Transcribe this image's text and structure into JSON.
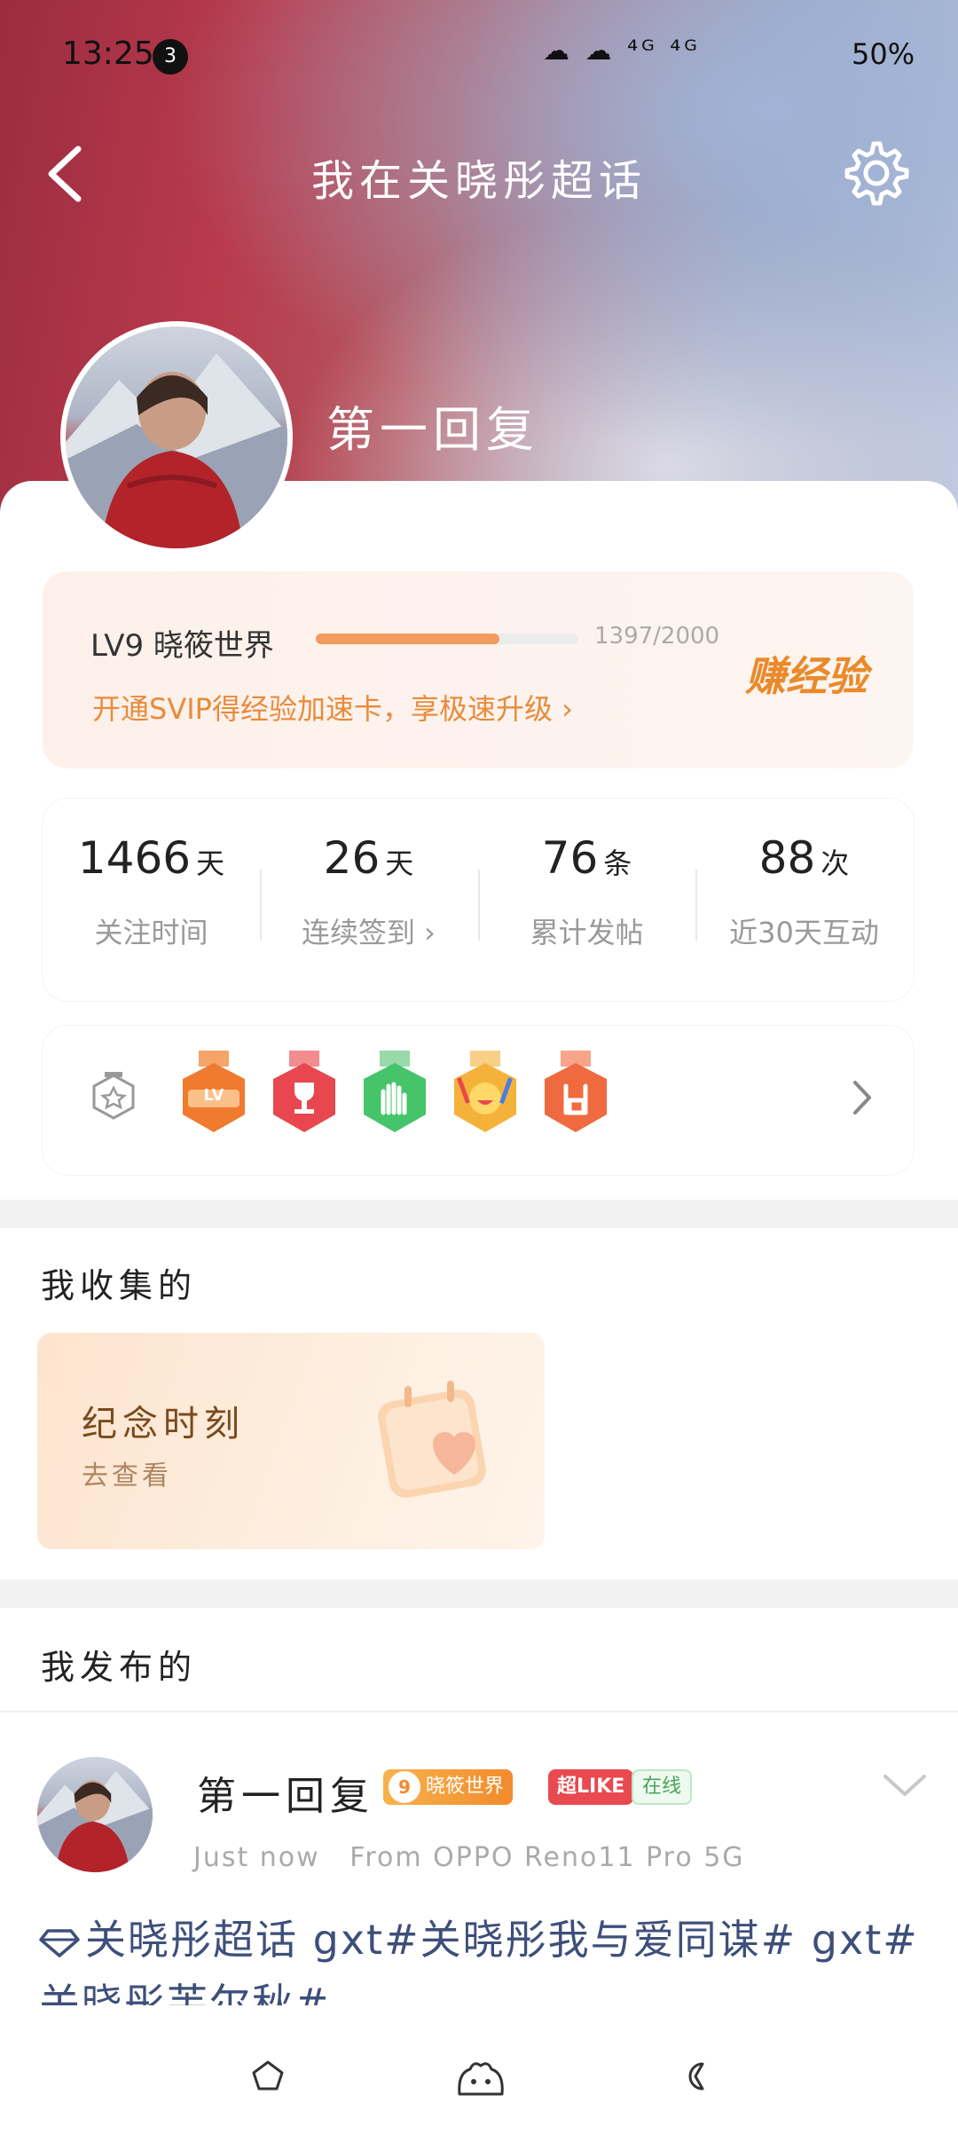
{
  "status_bar": {
    "time": "13:25",
    "notification_count": "3",
    "icons_text": "☁ ☁ ⁴ᴳ ⁴ᴳ",
    "battery": "50%"
  },
  "nav": {
    "title": "我在关晓彤超话",
    "back_icon": "chevron-left-icon",
    "settings_icon": "gear-icon"
  },
  "profile": {
    "name": "第一回复"
  },
  "level": {
    "name": "LV9 晓筱世界",
    "progress_text": "1397/2000",
    "progress_fraction": 0.6985,
    "earn_label": "赚经验",
    "svip_promo": "开通SVIP得经验加速卡，享极速升级",
    "promo_chevron": "›"
  },
  "stats": [
    {
      "value": "1466",
      "unit": "天",
      "label": "关注时间"
    },
    {
      "value": "26",
      "unit": "天",
      "label": "连续签到 ›"
    },
    {
      "value": "76",
      "unit": "条",
      "label": "累计发帖"
    },
    {
      "value": "88",
      "unit": "次",
      "label": "近30天互动"
    }
  ],
  "badges": {
    "medals": [
      {
        "name": "lv-medal",
        "label": "LV",
        "color": "#f07a2e"
      },
      {
        "name": "trophy-medal",
        "label": "",
        "color": "#e8474f"
      },
      {
        "name": "hand-medal",
        "label": "",
        "color": "#46c46a"
      },
      {
        "name": "cheer-medal",
        "label": "",
        "color": "#f5b23a"
      },
      {
        "name": "rock-hand-medal",
        "label": "",
        "color": "#f06a40"
      }
    ]
  },
  "collections": {
    "title": "我收集的",
    "memory_card": {
      "title": "纪念时刻",
      "link": "去查看"
    }
  },
  "posts": {
    "title": "我发布的",
    "item": {
      "author": "第一回复",
      "level_num": "9",
      "level_tag": "晓筱世界",
      "like_tag": "超LIKE",
      "online_tag": "在线",
      "time": "Just now",
      "source": "From OPPO Reno11 Pro 5G",
      "content": "关晓彤超话 gxt#关晓彤我与爱同谋# gxt#关晓彤芙尔秋#"
    }
  },
  "colors": {
    "accent_orange": "#f29b5e",
    "link_blue": "#3d4f7a"
  }
}
